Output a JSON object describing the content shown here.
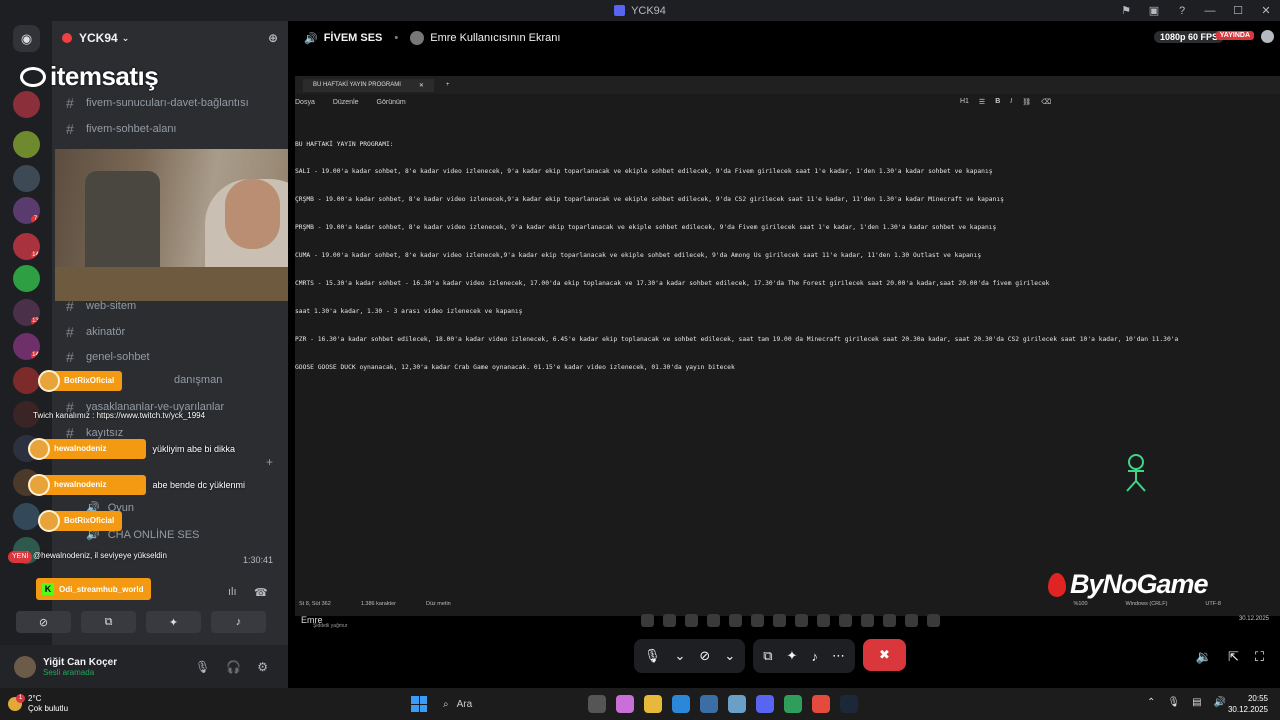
{
  "window": {
    "title": "YCK94",
    "controls": [
      "minimize",
      "maximize",
      "close"
    ]
  },
  "server": {
    "name": "YCK94"
  },
  "overlay": {
    "brand": "itemsatış"
  },
  "channels": [
    {
      "name": "fivem-sunucuları-davet-bağlantısı"
    },
    {
      "name": "fivem-sohbet-alanı"
    },
    {
      "name": "web-sitem"
    },
    {
      "name": "akinatör"
    },
    {
      "name": "genel-sohbet"
    },
    {
      "name": "danışman"
    },
    {
      "name": "yasaklananlar-ve-uyarılanlar"
    },
    {
      "name": "kayıtsız"
    },
    {
      "name": "Oyun"
    },
    {
      "name": "CHA ONLİNE SES"
    }
  ],
  "chat": {
    "bot1": "BotRixOficial",
    "twitch": "Twich kanalımız : https://www.twitch.tv/yck_1994",
    "msg1_user": "hewalnodeniz",
    "msg1_text": "yükliyim abe bi dikka",
    "msg2_user": "hewalnodeniz",
    "msg2_text": "abe bende dc yüklenmi",
    "bot2": "BotRixOficial",
    "rank": "@hewalnodeniz, il seviyeye yükseldin",
    "new_badge": "YENİ",
    "streamhub": "Odi_streamhub_world"
  },
  "voice": {
    "timer": "1:30:41"
  },
  "user": {
    "name": "Yiğit Can Koçer",
    "status": "Sesli aramada"
  },
  "stream": {
    "channel": "FİVEM SES",
    "viewer": "Emre Kullanıcısının Ekranı",
    "quality": "1080p 60 FPS",
    "live": "YAYINDA"
  },
  "notepad": {
    "tab": "BU HAFTAKİ YAYIN PROGRAMI",
    "menu": [
      "Dosya",
      "Düzenle",
      "Görünüm"
    ],
    "heading_tool": "H1",
    "lines": [
      "BU HAFTAKİ YAYIN PROGRAMI:",
      "SALI - 19.00'a kadar sohbet, 8'e kadar video izlenecek, 9'a kadar ekip toparlanacak ve ekiple sohbet edilecek, 9'da Fivem girilecek saat 1'e kadar, 1'den 1.30'a kadar sohbet ve kapanış",
      "ÇRŞMB - 19.00'a kadar sohbet, 8'e kadar video izlenecek,9'a kadar ekip toparlanacak ve ekiple sohbet edilecek, 9'da CS2 girilecek saat 11'e kadar, 11'den 1.30'a kadar Minecraft ve kapanış",
      "PRŞMB - 19.00'a kadar sohbet, 8'e kadar video izlenecek, 9'a kadar ekip toparlanacak ve ekiple sohbet edilecek, 9'da Fivem girilecek saat 1'e kadar, 1'den 1.30'a kadar sohbet ve kapanış",
      "CUMA - 19.00'a kadar sohbet, 8'e kadar video izlenecek,9'a kadar ekip toparlanacak ve ekiple sohbet edilecek, 9'da Among Us girilecek saat 11'e kadar, 11'den 1.30 Outlast ve kapanış",
      "CMRTS - 15.30'a kadar sohbet - 16.30'a kadar video izlenecek, 17.00'da ekip toplanacak ve 17.30'a kadar sohbet edilecek, 17.30'da The Forest girilecek saat 20.00'a kadar,saat 20.00'da fivem girilecek",
      "saat 1.30'a kadar, 1.30 - 3 arası video izlenecek ve kapanış",
      "PZR - 16.30'a kadar sohbet edilecek, 18.00'a kadar video izlenecek, 6.45'e kadar ekip toplanacak ve sohbet edilecek, saat tam 19.00 da Minecraft girilecek saat 20.30a kadar, saat 20.30'da CS2 girilecek saat 10'a kadar, 10'dan 11.30'a",
      "GOOSE GOOSE DUCK oynanacak, 12,30'a kadar Crab Game oynanacak. 01.15'e kadar video izlenecek, 01.30'da yayın bitecek"
    ],
    "status_pos": "St 8, Süt 362",
    "status_chars": "1.386 karakter",
    "status_format": "Düz metin",
    "status_zoom": "%100",
    "status_eol": "Windows (CRLF)",
    "status_enc": "UTF-8"
  },
  "inner_taskbar": {
    "user": "Emre",
    "weather": "Şiddetli yağmur",
    "date": "30.12.2025"
  },
  "logos": {
    "bynogame": "ByNoGame"
  },
  "taskbar": {
    "temp": "2°C",
    "weather": "Çok bulutlu",
    "search": "Ara",
    "time": "20:55",
    "date": "30.12.2025"
  }
}
